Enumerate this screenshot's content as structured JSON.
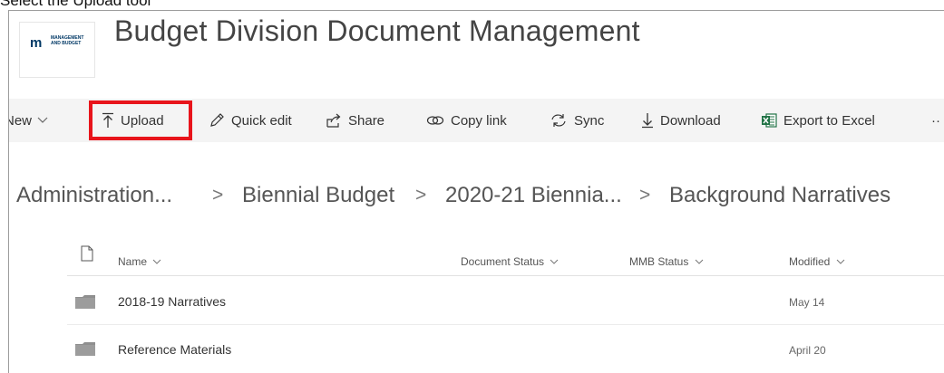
{
  "caption": "Select the Upload tool",
  "site": {
    "logo_mark": "m",
    "logo_text": "MANAGEMENT\nAND BUDGET",
    "title": "Budget Division Document Management"
  },
  "command_bar": {
    "new_label": "New",
    "upload_label": "Upload",
    "quick_edit_label": "Quick edit",
    "share_label": "Share",
    "copy_link_label": "Copy link",
    "sync_label": "Sync",
    "download_label": "Download",
    "export_label": "Export to Excel",
    "more_label": "··",
    "highlight_color": "#e8141b"
  },
  "breadcrumb": {
    "items": [
      "Administration...",
      "Biennial Budget",
      "2020-21 Biennia...",
      "Background Narratives"
    ],
    "separator": ">"
  },
  "table": {
    "columns": {
      "name": "Name",
      "document_status": "Document Status",
      "mmb_status": "MMB Status",
      "modified": "Modified"
    },
    "rows": [
      {
        "name": "2018-19 Narratives",
        "modified": "May 14",
        "icon": "folder-icon"
      },
      {
        "name": "Reference Materials",
        "modified": "April 20",
        "icon": "folder-icon"
      }
    ]
  },
  "colors": {
    "accent": "#0078d4",
    "excel": "#217346",
    "title_text": "#444444"
  }
}
